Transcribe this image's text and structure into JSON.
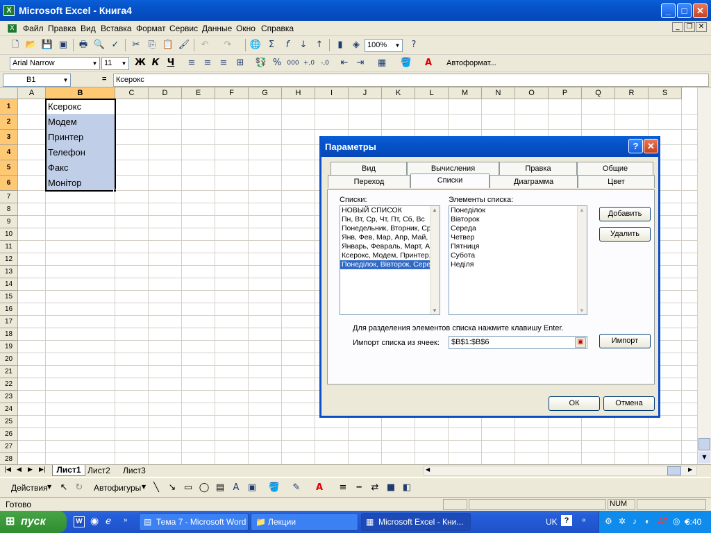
{
  "window": {
    "title": "Microsoft Excel - Книга4",
    "app_icon": "X"
  },
  "menu": [
    "Файл",
    "Правка",
    "Вид",
    "Вставка",
    "Формат",
    "Сервис",
    "Данные",
    "Окно",
    "Справка"
  ],
  "toolbar": {
    "zoom": "100%",
    "font": "Arial Narrow",
    "size": "11",
    "bold": "Ж",
    "italic": "К",
    "underline": "Ч",
    "autoformat": "Автоформат..."
  },
  "formula_bar": {
    "name_box": "B1",
    "equals": "=",
    "content": "Ксерокс"
  },
  "grid": {
    "columns": [
      "A",
      "B",
      "C",
      "D",
      "E",
      "F",
      "G",
      "H",
      "I",
      "J",
      "K",
      "L",
      "M",
      "N",
      "O",
      "P",
      "Q",
      "R",
      "S"
    ],
    "rows": [
      "1",
      "2",
      "3",
      "4",
      "5",
      "6",
      "7",
      "8",
      "9",
      "10",
      "11",
      "12",
      "13",
      "14",
      "15",
      "16",
      "17",
      "18",
      "19",
      "20",
      "21",
      "22",
      "23",
      "24",
      "25",
      "26",
      "27",
      "28"
    ],
    "cells_b": [
      "Ксерокс",
      "Модем",
      "Принтер",
      "Телефон",
      "Факс",
      "Монітор"
    ]
  },
  "sheet_tabs": [
    "Лист1",
    "Лист2",
    "Лист3"
  ],
  "draw_toolbar": {
    "actions": "Действия",
    "autoshapes": "Автофигуры"
  },
  "status": {
    "ready": "Готово",
    "num": "NUM"
  },
  "taskbar": {
    "start": "пуск",
    "tasks": [
      "Тема 7 - Microsoft Word",
      "Лекции",
      "Microsoft Excel - Кни..."
    ],
    "lang": "UK",
    "time": "6:40"
  },
  "dialog": {
    "title": "Параметры",
    "tabs_row1": [
      "Вид",
      "Вычисления",
      "Правка",
      "Общие"
    ],
    "tabs_row2": [
      "Переход",
      "Списки",
      "Диаграмма",
      "Цвет"
    ],
    "lists_label": "Списки:",
    "lists": [
      "НОВЫЙ СПИСОК",
      "Пн, Вт, Ср, Чт, Пт, Сб, Вс",
      "Понедельник, Вторник, Ср",
      "Янв, Фев, Мар, Апр, Май,",
      "Январь, Февраль, Март, Ап",
      "Ксерокс, Модем, Принтер,",
      "Понеділок, Вівторок, Сере"
    ],
    "entries_label": "Элементы списка:",
    "entries": [
      "Понеділок",
      "Вівторок",
      "Середа",
      "Четвер",
      "Пятниця",
      "Субота",
      "Неділя"
    ],
    "add_button": "Добавить",
    "delete_button": "Удалить",
    "hint": "Для разделения элементов списка нажмите клавишу Enter.",
    "import_label": "Импорт списка из ячеек:",
    "import_value": "$B$1:$B$6",
    "import_button": "Импорт",
    "ok_button": "ОК",
    "cancel_button": "Отмена"
  },
  "colors": {
    "accent": "#0a5fd8",
    "selection": "#316ac5",
    "range_fill": "#c0cee8",
    "chrome": "#ece9d8"
  }
}
